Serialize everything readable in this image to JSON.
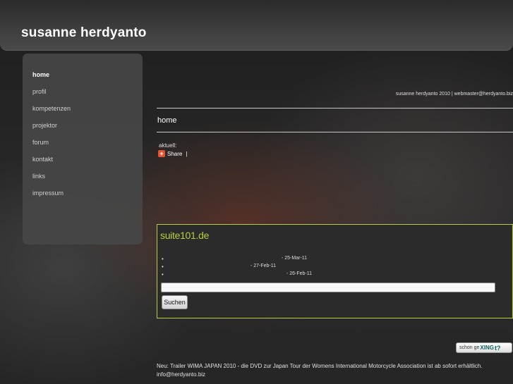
{
  "header": {
    "title": "susanne herdyanto"
  },
  "nav": {
    "items": [
      {
        "label": "home",
        "active": true
      },
      {
        "label": "profil"
      },
      {
        "label": "kompetenzen"
      },
      {
        "label": "projektor"
      },
      {
        "label": "forum"
      },
      {
        "label": "kontakt"
      },
      {
        "label": "links"
      },
      {
        "label": "impressum"
      }
    ]
  },
  "credit": "susanne herdyanto 2010 | webmaster@herdyanto.biz",
  "main": {
    "heading": "home",
    "aktuell_label": "aktuell:",
    "share_label": "Share",
    "share_separator": "|",
    "share_icon": "plus-icon"
  },
  "suite101": {
    "logo_text": "suite101.de",
    "bullet": "•",
    "items": [
      {
        "date": "- 25-Mar-11"
      },
      {
        "date": "- 27-Feb-11"
      },
      {
        "date": "- 26-Feb-11"
      }
    ],
    "search_value": "",
    "search_button": "Suchen",
    "accent_color": "#b6cf3a"
  },
  "xing": {
    "prefix": "schon ge",
    "brand": "XING",
    "suffix": "t?"
  },
  "footer": {
    "line1": "Neu: Trailer WIMA JAPAN 2010 - die DVD zur Japan Tour der Womens International Motorcycle Association ist ab sofort erhältlich.",
    "line2": "info@herdyanto.biz"
  }
}
